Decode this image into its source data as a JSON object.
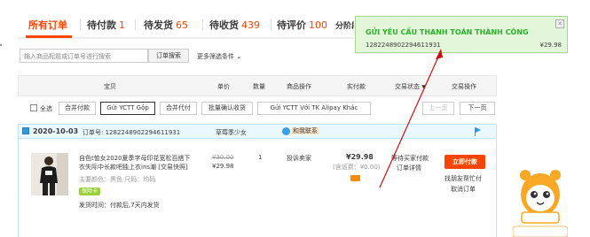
{
  "tabs": [
    {
      "label": "所有订单",
      "count": ""
    },
    {
      "label": "待付款",
      "count": "1"
    },
    {
      "label": "待发货",
      "count": "65"
    },
    {
      "label": "待收货",
      "count": "439"
    },
    {
      "label": "待评价",
      "count": "100"
    },
    {
      "label": "分阶段",
      "count": ""
    }
  ],
  "search": {
    "placeholder": "输入商品标题或订单号进行搜索",
    "button": "订单搜索",
    "more": "更多筛选条件"
  },
  "columns": {
    "item": "宝贝",
    "unit_price": "单价",
    "quantity": "数量",
    "item_ops": "商品操作",
    "actual_paid": "实付款",
    "trade_status": "交易状态",
    "trade_ops": "交易操作"
  },
  "toolbar": {
    "select_all": "全选",
    "merge_pay": "合并付款",
    "gui_ytct_gop": "Gửi YCTT Gộp",
    "merge_proxy": "合并代付",
    "batch_confirm": "批量确认收货",
    "gui_alipay": "Gửi YCTT Với TK Alipay Khác",
    "prev": "上一页",
    "next": "下一页"
  },
  "order": {
    "date": "2020-10-03",
    "order_no_label": "订单号:",
    "order_no": "1282248902294611931",
    "shop": "草莓季少女",
    "contact": "和我联系",
    "title_line1": "自色t恤女2020夏季字母印花宽松百搭下",
    "title_line2": "衣失际中长款吧独上衣ins潮 [交易快照]",
    "attrs": "主要颜色：黑色  尺码：均码",
    "badge": "保险卡",
    "ship_time": "发货时间：付款后,7天内发货",
    "orig_price": "¥30.00",
    "price": "¥29.98",
    "qty": "1",
    "complain": "投诉卖家",
    "paid": "¥29.98",
    "freight": "(含运费：¥0.00)",
    "status1": "等待买家付款",
    "status2": "订单详情",
    "pay_button": "立即付款",
    "friend_pay": "找朋友帮忙付",
    "cancel": "取消订单"
  },
  "popup": {
    "title": "GỬI YÊU CẦU THANH TOÁN THÀNH CÔNG",
    "order_id": "1282248902294611931",
    "amount": "¥29.98"
  },
  "colors": {
    "accent": "#ff4400",
    "success": "#2bb02b",
    "arrow": "#cc1111"
  }
}
